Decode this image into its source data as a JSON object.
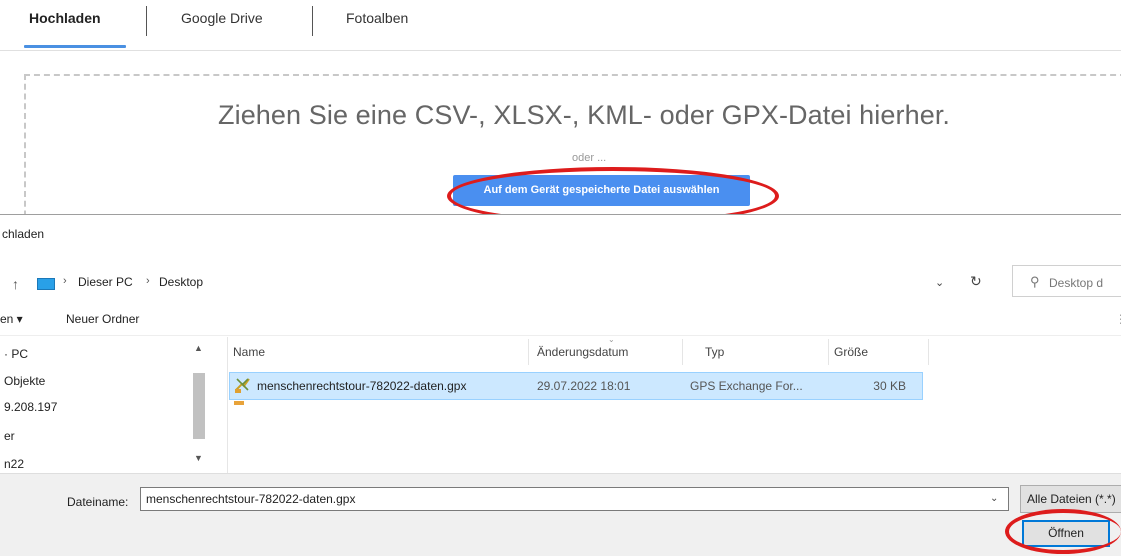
{
  "upload_panel": {
    "tabs": [
      {
        "label": "Hochladen",
        "active": true
      },
      {
        "label": "Google Drive",
        "active": false
      },
      {
        "label": "Fotoalben",
        "active": false
      }
    ],
    "drop_title": "Ziehen Sie eine CSV-, XLSX-, KML- oder GPX-Datei hierher.",
    "drop_or": "oder ...",
    "select_button": "Auf dem Gerät gespeicherte Datei auswählen",
    "accent_color": "#4a8ff0"
  },
  "file_dialog": {
    "title": "chladen",
    "breadcrumb": [
      "Dieser PC",
      "Desktop"
    ],
    "search_placeholder": "Desktop d",
    "toolbar": {
      "organize": "en ▾",
      "new_folder": "Neuer Ordner"
    },
    "nav_items": [
      "· PC",
      "Objekte",
      "9.208.197",
      "er",
      "n22"
    ],
    "columns": {
      "name": "Name",
      "date": "Änderungsdatum",
      "type": "Typ",
      "size": "Größe"
    },
    "files": [
      {
        "name": "menschenrechtstour-782022-daten.gpx",
        "date": "29.07.2022 18:01",
        "type": "GPS Exchange For...",
        "size": "30 KB",
        "icon": "gpx-file-icon"
      }
    ],
    "filename_label": "Dateiname:",
    "filename_value": "menschenrechtstour-782022-daten.gpx",
    "filter_label": "Alle Dateien (*.*)",
    "open_button": "Öffnen"
  },
  "annotation_color": "#dd1c1c"
}
